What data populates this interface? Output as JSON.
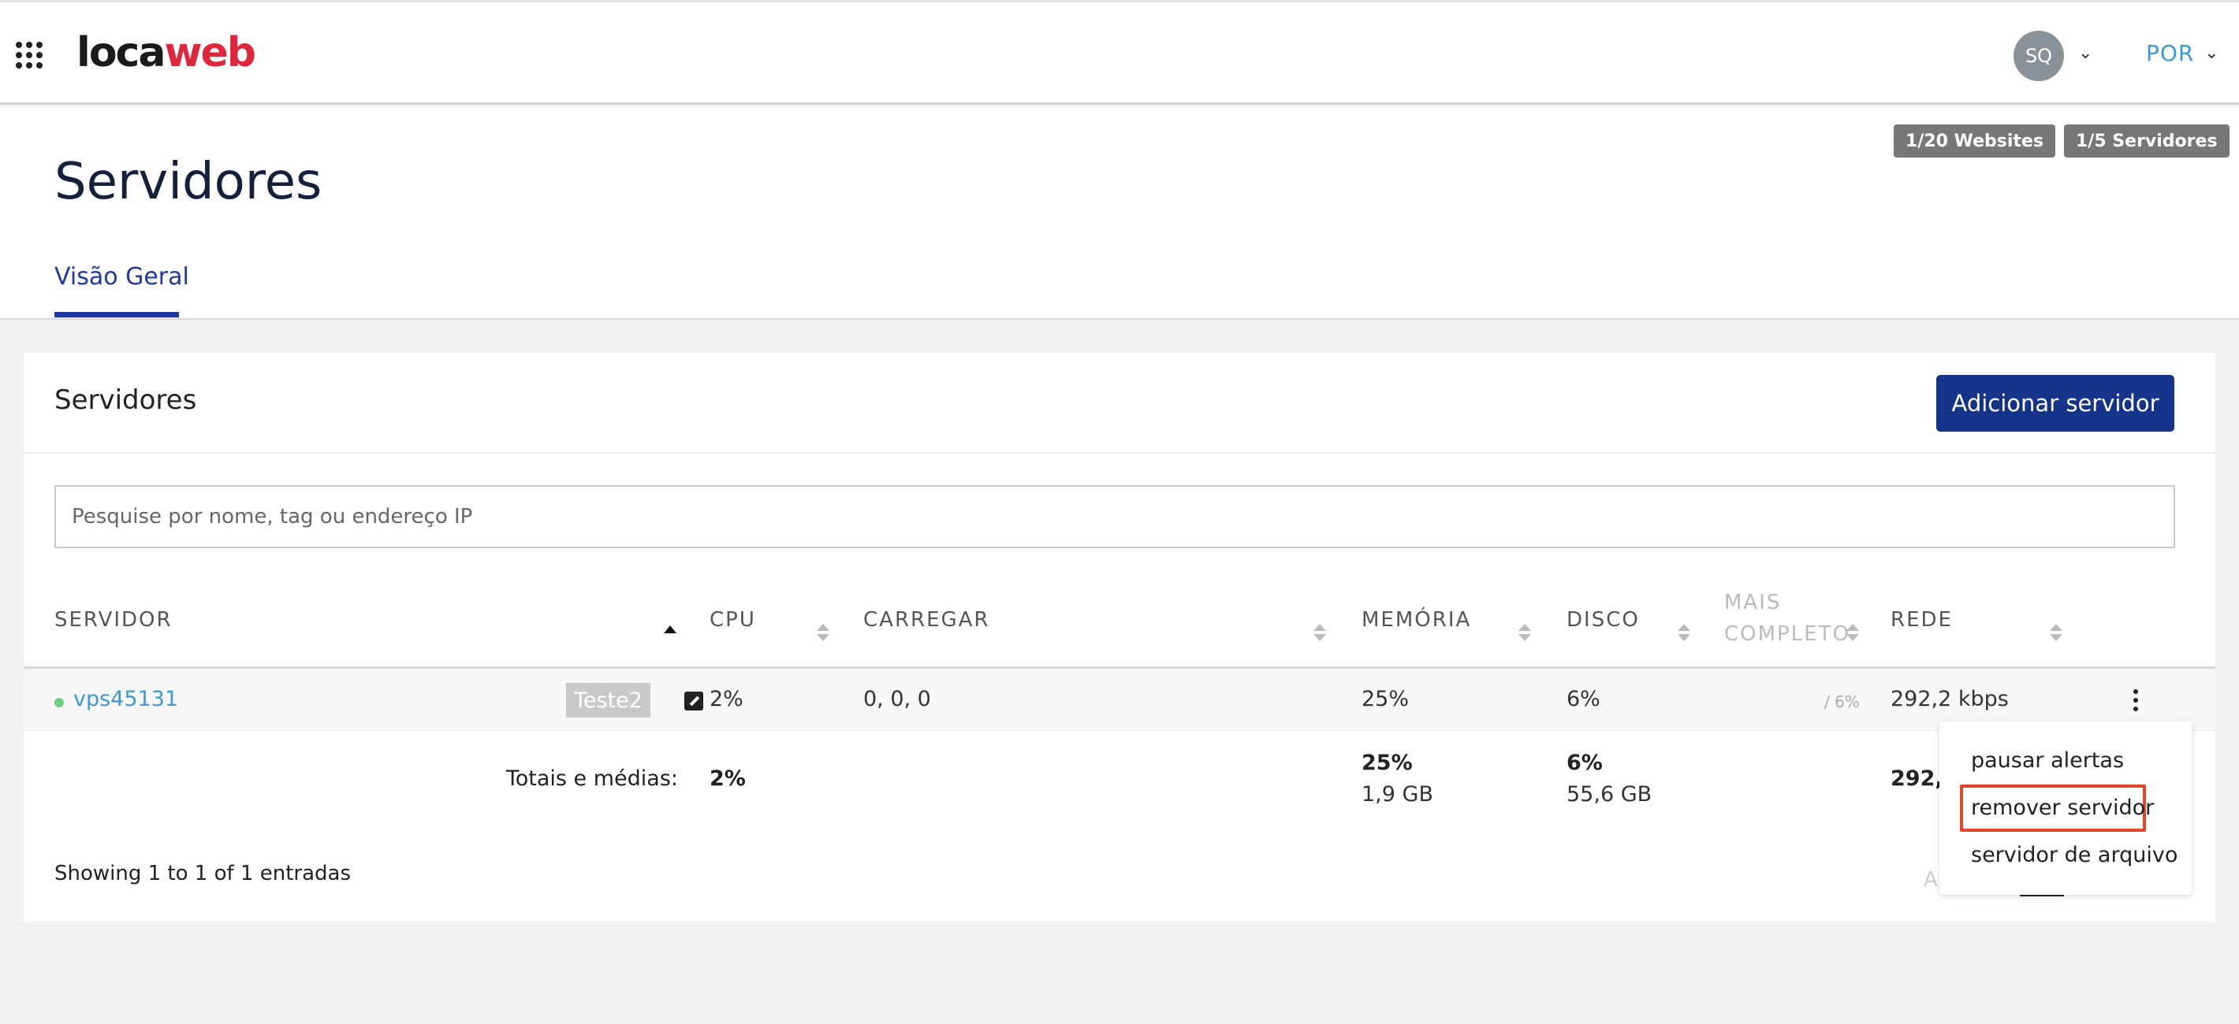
{
  "header": {
    "logo_part1": "loca",
    "logo_part2": "web",
    "avatar_initials": "SQ",
    "language": "POR"
  },
  "page": {
    "title": "Servidores",
    "badges": [
      "1/20 Websites",
      "1/5 Servidores"
    ],
    "tab": "Visão Geral"
  },
  "card": {
    "title": "Servidores",
    "add_button": "Adicionar servidor",
    "search_placeholder": "Pesquise por nome, tag ou endereço IP"
  },
  "table": {
    "columns": {
      "servidor": "SERVIDOR",
      "cpu": "CPU",
      "carregar": "CARREGAR",
      "memoria": "MEMÓRIA",
      "disco": "DISCO",
      "mais1": "MAIS",
      "mais2": "COMPLETO",
      "rede": "REDE"
    },
    "row": {
      "name": "vps45131",
      "tag": "Teste2",
      "cpu": "2%",
      "load": "0, 0, 0",
      "memory": "25%",
      "disk": "6%",
      "fullest": "/ 6%",
      "network": "292,2 kbps"
    },
    "totals": {
      "label": "Totais e médias:",
      "cpu": "2%",
      "memory_pct": "25%",
      "memory_size": "1,9 GB",
      "disk_pct": "6%",
      "disk_size": "55,6 GB",
      "network": "292,2"
    },
    "showing": "Showing 1 to 1 of 1 entradas",
    "pager_partial": "A"
  },
  "menu": {
    "items": [
      "pausar alertas",
      "remover servidor",
      "servidor de arquivo"
    ]
  },
  "colors": {
    "brand_blue": "#16338a",
    "link_blue": "#3a9ad9",
    "logo_red": "#e0263a",
    "highlight_red": "#e1462a",
    "status_green": "#6ccf7d"
  }
}
